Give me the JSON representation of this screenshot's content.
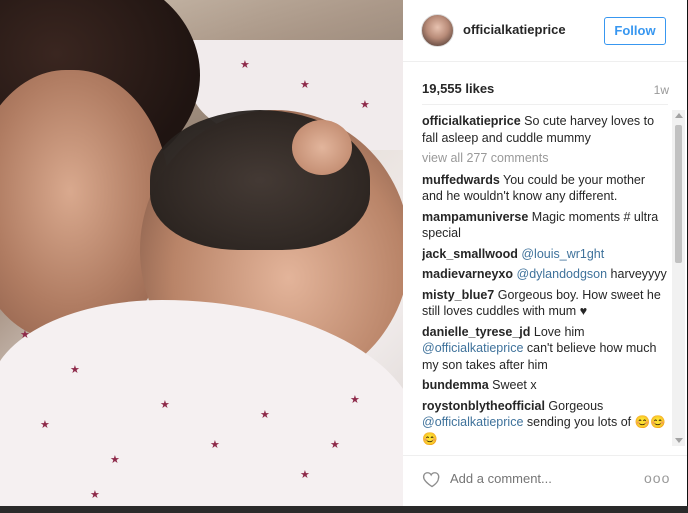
{
  "post": {
    "username": "officialkatieprice",
    "follow_label": "Follow",
    "likes": "19,555 likes",
    "age": "1w",
    "caption": {
      "user": "officialkatieprice",
      "text": " So cute harvey loves to fall asleep and cuddle mummy"
    },
    "view_all": "view all 277 comments",
    "comments": [
      {
        "user": "muffedwards",
        "text": " You could be your mother and he wouldn't know any different."
      },
      {
        "user": "mampamuniverse",
        "text": " Magic moments # ultra special"
      },
      {
        "user": "jack_smallwood",
        "mention": "@louis_wr1ght",
        "text": ""
      },
      {
        "user": "madievarneyxo",
        "mention": "@dylandodgson",
        "text": " harveyyyy"
      },
      {
        "user": "misty_blue7",
        "text": " Gorgeous boy. How sweet he still loves cuddles with mum ♥"
      },
      {
        "user": "danielle_tyrese_jd",
        "text_before": " Love him ",
        "mention": "@officialkatieprice",
        "text": " can't believe how much my son takes after him"
      },
      {
        "user": "bundemma",
        "text": " Sweet x"
      },
      {
        "user": "roystonblytheofficial",
        "text_before": " Gorgeous ",
        "mention": "@officialkatieprice",
        "text": " sending you lots of 😊😊😊"
      }
    ],
    "add_comment_placeholder": "Add a comment...",
    "more_label": "ooo"
  },
  "icons": {
    "heart": "heart-icon",
    "avatar": "avatar",
    "more": "more-options-icon"
  },
  "colors": {
    "link": "#3f729b",
    "follow": "#3897f0",
    "muted": "#999999"
  }
}
